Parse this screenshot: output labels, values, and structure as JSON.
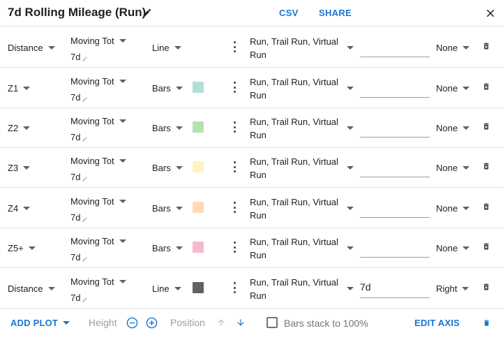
{
  "header": {
    "title": "7d Rolling Mileage (Run)",
    "csv_label": "CSV",
    "share_label": "SHARE",
    "edit_icon": "pencil-icon",
    "close_icon": "close-icon"
  },
  "rows": [
    {
      "metric": "Distance",
      "agg": "Moving Tot",
      "window_suffix": "7d",
      "style": "Bars",
      "style_display": "Line",
      "color": null,
      "sports_line1": "Run, Trail Run, Virtual",
      "sports_line2": "Run",
      "window_value": "",
      "axis": "None"
    },
    {
      "metric": "Z1",
      "agg": "Moving Tot",
      "window_suffix": "7d",
      "style_display": "Bars",
      "color": "#b2dfdb",
      "sports_line1": "Run, Trail Run, Virtual",
      "sports_line2": "Run",
      "window_value": "",
      "axis": "None"
    },
    {
      "metric": "Z2",
      "agg": "Moving Tot",
      "window_suffix": "7d",
      "style_display": "Bars",
      "color": "#b7e1b5",
      "sports_line1": "Run, Trail Run, Virtual",
      "sports_line2": "Run",
      "window_value": "",
      "axis": "None"
    },
    {
      "metric": "Z3",
      "agg": "Moving Tot",
      "window_suffix": "7d",
      "style_display": "Bars",
      "color": "#fff3bf",
      "sports_line1": "Run, Trail Run, Virtual",
      "sports_line2": "Run",
      "window_value": "",
      "axis": "None"
    },
    {
      "metric": "Z4",
      "agg": "Moving Tot",
      "window_suffix": "7d",
      "style_display": "Bars",
      "color": "#ffdab9",
      "sports_line1": "Run, Trail Run, Virtual",
      "sports_line2": "Run",
      "window_value": "",
      "axis": "None"
    },
    {
      "metric": "Z5+",
      "agg": "Moving Tot",
      "window_suffix": "7d",
      "style_display": "Bars",
      "color": "#f7b9cc",
      "sports_line1": "Run, Trail Run, Virtual",
      "sports_line2": "Run",
      "window_value": "",
      "axis": "None"
    },
    {
      "metric": "Distance",
      "agg": "Moving Tot",
      "window_suffix": "7d",
      "style_display": "Line",
      "color": "#616161",
      "sports_line1": "Run, Trail Run, Virtual",
      "sports_line2": "Run",
      "window_value": "7d",
      "axis": "Right"
    }
  ],
  "footer": {
    "add_plot_label": "ADD PLOT",
    "height_label": "Height",
    "position_label": "Position",
    "stack_label": "Bars stack to 100%",
    "stack_checked": false,
    "edit_axis_label": "EDIT AXIS"
  },
  "colors": {
    "accent": "#1976d2",
    "divider": "#e0e0e0"
  }
}
